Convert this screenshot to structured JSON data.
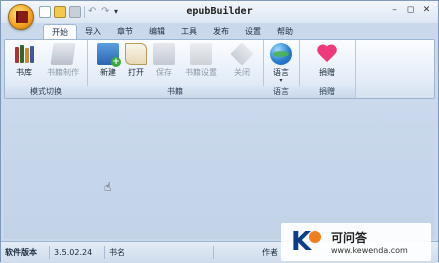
{
  "window": {
    "title": "epubBuilder"
  },
  "quick_access": {
    "icons": [
      "new-file-icon",
      "open-folder-icon",
      "save-icon",
      "undo-icon",
      "redo-icon"
    ],
    "more": "▾"
  },
  "window_controls": {
    "minimize": "–",
    "restore": "◻",
    "close": "✕"
  },
  "tabs": [
    {
      "label": "开始",
      "active": true
    },
    {
      "label": "导入"
    },
    {
      "label": "章节"
    },
    {
      "label": "编辑"
    },
    {
      "label": "工具"
    },
    {
      "label": "发布"
    },
    {
      "label": "设置"
    },
    {
      "label": "帮助"
    }
  ],
  "ribbon": {
    "groups": [
      {
        "label": "模式切换",
        "buttons": [
          {
            "label": "书库",
            "icon": "library-icon",
            "enabled": true
          },
          {
            "label": "书籍制作",
            "icon": "book-making-icon",
            "enabled": false
          }
        ]
      },
      {
        "label": "书籍",
        "buttons": [
          {
            "label": "新建",
            "icon": "new-book-icon",
            "enabled": true
          },
          {
            "label": "打开",
            "icon": "open-book-icon",
            "enabled": true
          },
          {
            "label": "保存",
            "icon": "save-icon",
            "enabled": false
          },
          {
            "label": "书籍设置",
            "icon": "book-settings-icon",
            "enabled": false
          },
          {
            "label": "关闭",
            "icon": "close-book-icon",
            "enabled": false
          }
        ]
      },
      {
        "label": "语言",
        "buttons": [
          {
            "label": "语言",
            "icon": "globe-icon",
            "enabled": true
          }
        ]
      },
      {
        "label": "捐赠",
        "buttons": [
          {
            "label": "捐赠",
            "icon": "heart-icon",
            "enabled": true
          }
        ]
      }
    ]
  },
  "statusbar": {
    "software_version_label": "软件版本",
    "software_version": "3.5.02.24",
    "book_name_label": "书名",
    "author_label": "作者"
  },
  "watermark": {
    "brand_cn": "可问答",
    "url": "www.kewenda.com"
  },
  "colors": {
    "accent": "#f0a020",
    "ribbon_bg": "#e3ecf7",
    "content_bg": "#c6d6ea"
  }
}
